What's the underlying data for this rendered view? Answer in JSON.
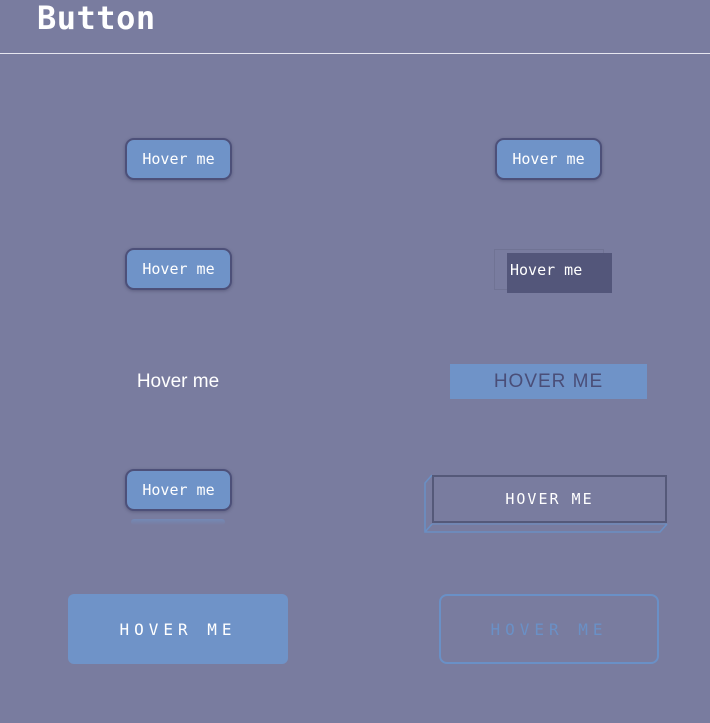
{
  "header": {
    "title": "Button"
  },
  "buttons": [
    {
      "label": "Hover me"
    },
    {
      "label": "Hover me"
    },
    {
      "label": "Hover me"
    },
    {
      "label": "Hover me"
    },
    {
      "label": "Hover me"
    },
    {
      "label": "HOVER ME"
    },
    {
      "label": "Hover me"
    },
    {
      "label": "HOVER ME"
    },
    {
      "label": "HOVER ME"
    },
    {
      "label": "HOVER ME"
    }
  ],
  "colors": {
    "background": "#797c9f",
    "accent": "#6f93c8",
    "dark": "#53567a",
    "white": "#ffffff"
  }
}
